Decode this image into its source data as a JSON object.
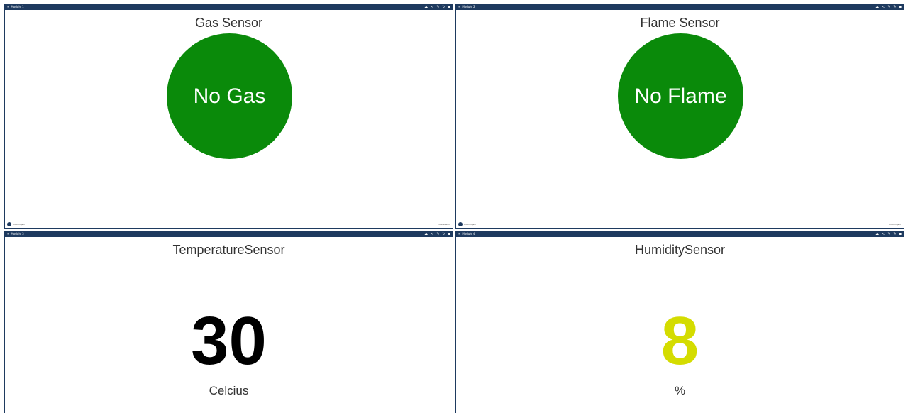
{
  "colors": {
    "titlebar": "#1e3a5f",
    "circle_ok": "#0a8a0a",
    "temperature_value": "#000000",
    "humidity_value": "#d4dc00"
  },
  "panels": [
    {
      "header_label": "Module 1",
      "title": "Gas Sensor",
      "status": "No Gas",
      "footer_left": "thethingsio",
      "footer_right": "Made with"
    },
    {
      "header_label": "Module 2",
      "title": "Flame Sensor",
      "status": "No Flame",
      "footer_left": "thethingsio",
      "footer_right": "thethingsio"
    },
    {
      "header_label": "Module 3",
      "title": "TemperatureSensor",
      "value": "30",
      "unit": "Celcius"
    },
    {
      "header_label": "Module 4",
      "title": "HumiditySensor",
      "value": "8",
      "unit": "%"
    }
  ],
  "titlebar_icons": [
    "cloud-icon",
    "share-icon",
    "edit-icon",
    "refresh-icon",
    "close-icon"
  ],
  "titlebar_glyphs": {
    "lead": "≡",
    "cloud": "☁",
    "share": "<",
    "edit": "✎",
    "refresh": "↻",
    "close": "▪"
  }
}
